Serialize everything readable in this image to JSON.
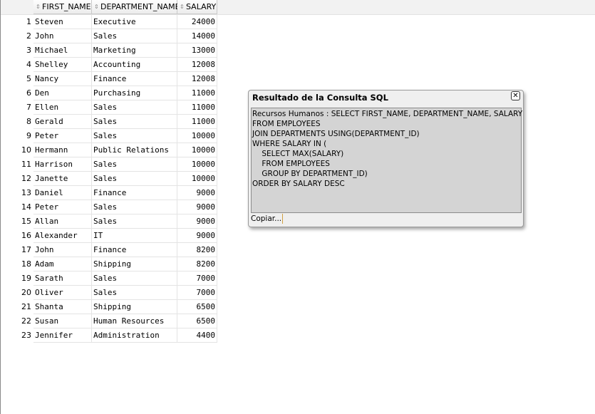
{
  "grid": {
    "columns": [
      "FIRST_NAME",
      "DEPARTMENT_NAME",
      "SALARY"
    ],
    "rows": [
      {
        "num": "1",
        "first_name": "Steven",
        "department": "Executive",
        "salary": "24000"
      },
      {
        "num": "2",
        "first_name": "John",
        "department": "Sales",
        "salary": "14000"
      },
      {
        "num": "3",
        "first_name": "Michael",
        "department": "Marketing",
        "salary": "13000"
      },
      {
        "num": "4",
        "first_name": "Shelley",
        "department": "Accounting",
        "salary": "12008"
      },
      {
        "num": "5",
        "first_name": "Nancy",
        "department": "Finance",
        "salary": "12008"
      },
      {
        "num": "6",
        "first_name": "Den",
        "department": "Purchasing",
        "salary": "11000"
      },
      {
        "num": "7",
        "first_name": "Ellen",
        "department": "Sales",
        "salary": "11000"
      },
      {
        "num": "8",
        "first_name": "Gerald",
        "department": "Sales",
        "salary": "11000"
      },
      {
        "num": "9",
        "first_name": "Peter",
        "department": "Sales",
        "salary": "10000"
      },
      {
        "num": "10",
        "first_name": "Hermann",
        "department": "Public Relations",
        "salary": "10000"
      },
      {
        "num": "11",
        "first_name": "Harrison",
        "department": "Sales",
        "salary": "10000"
      },
      {
        "num": "12",
        "first_name": "Janette",
        "department": "Sales",
        "salary": "10000"
      },
      {
        "num": "13",
        "first_name": "Daniel",
        "department": "Finance",
        "salary": "9000"
      },
      {
        "num": "14",
        "first_name": "Peter",
        "department": "Sales",
        "salary": "9000"
      },
      {
        "num": "15",
        "first_name": "Allan",
        "department": "Sales",
        "salary": "9000"
      },
      {
        "num": "16",
        "first_name": "Alexander",
        "department": "IT",
        "salary": "9000"
      },
      {
        "num": "17",
        "first_name": "John",
        "department": "Finance",
        "salary": "8200"
      },
      {
        "num": "18",
        "first_name": "Adam",
        "department": "Shipping",
        "salary": "8200"
      },
      {
        "num": "19",
        "first_name": "Sarath",
        "department": "Sales",
        "salary": "7000"
      },
      {
        "num": "20",
        "first_name": "Oliver",
        "department": "Sales",
        "salary": "7000"
      },
      {
        "num": "21",
        "first_name": "Shanta",
        "department": "Shipping",
        "salary": "6500"
      },
      {
        "num": "22",
        "first_name": "Susan",
        "department": "Human Resources",
        "salary": "6500"
      },
      {
        "num": "23",
        "first_name": "Jennifer",
        "department": "Administration",
        "salary": "4400"
      }
    ]
  },
  "popup": {
    "title": "Resultado de la Consulta SQL",
    "close_icon": "close-icon",
    "sql_lines": [
      "Recursos Humanos : SELECT FIRST_NAME, DEPARTMENT_NAME, SALARY",
      "FROM EMPLOYEES",
      "JOIN DEPARTMENTS USING(DEPARTMENT_ID)",
      "WHERE SALARY IN (",
      "    SELECT MAX(SALARY)",
      "    FROM EMPLOYEES",
      "    GROUP BY DEPARTMENT_ID)",
      "ORDER BY SALARY DESC"
    ],
    "copy_label": "Copiar..."
  }
}
